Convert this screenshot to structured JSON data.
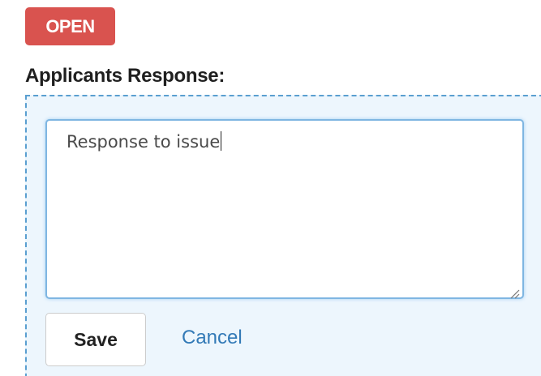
{
  "status": {
    "label": "OPEN",
    "color": "#d9534f"
  },
  "response_section": {
    "label": "Applicants Response:",
    "textarea_value": "Response to issue",
    "save_label": "Save",
    "cancel_label": "Cancel"
  },
  "icons": {
    "resize": "resize-grip-icon"
  },
  "colors": {
    "panel_background": "#edf6fd",
    "panel_border": "#5a9fd0",
    "focus_border": "#7fb6e2",
    "link": "#337ab7"
  }
}
